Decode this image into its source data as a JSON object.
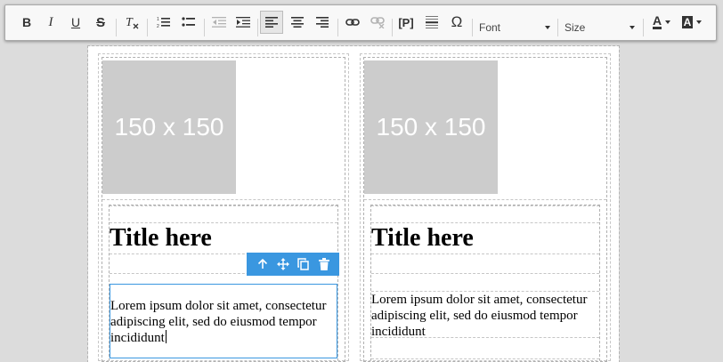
{
  "toolbar": {
    "bold": "B",
    "italic": "I",
    "underline": "U",
    "strike": "S",
    "font_label": "Font",
    "size_label": "Size",
    "special_char": "Ω",
    "paragraph_tag": "[P]",
    "text_color_letter": "A",
    "bg_color_letter": "A"
  },
  "columns": [
    {
      "image_label": "150 x 150",
      "title": "Title here",
      "paragraph": "Lorem ipsum dolor sit amet, consectetur adipiscing elit, sed do eiusmod tempor incididunt"
    },
    {
      "image_label": "150 x 150",
      "title": "Title here",
      "paragraph": "Lorem ipsum dolor sit amet, consectetur adipiscing elit, sed do eiusmod tempor incididunt"
    }
  ],
  "colors": {
    "selection": "#3a97e0",
    "placeholder": "#cccccc"
  }
}
